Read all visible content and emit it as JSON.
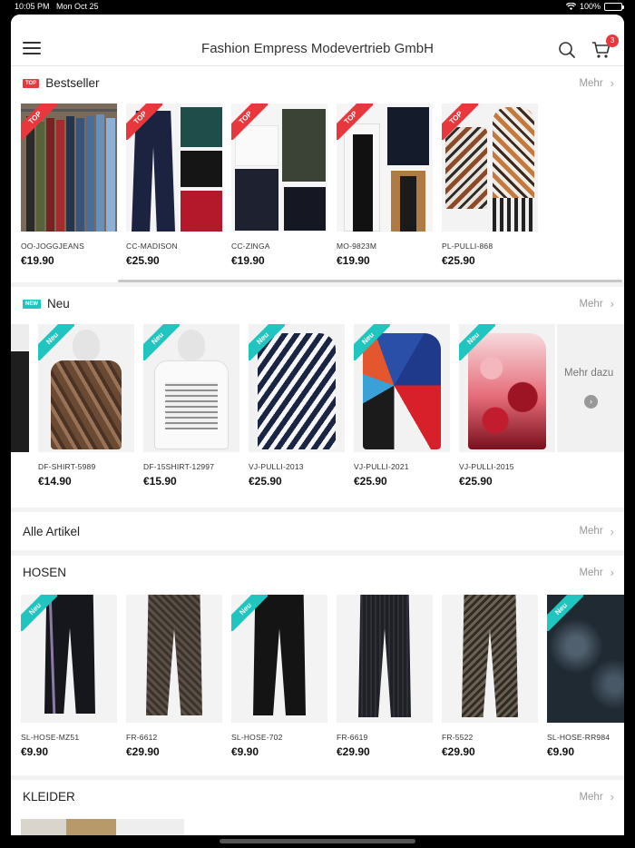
{
  "status": {
    "time": "10:05 PM",
    "date": "Mon Oct 25",
    "battery": "100%"
  },
  "header": {
    "title": "Fashion Empress Modevertrieb GmbH",
    "cart_count": "3"
  },
  "bestseller": {
    "tag": "TOP",
    "title": "Bestseller",
    "more": "Mehr",
    "items": [
      {
        "sku": "OO-JOGGJEANS",
        "price": "€19.90",
        "ribbon": "TOP"
      },
      {
        "sku": "CC-MADISON",
        "price": "€25.90",
        "ribbon": "TOP"
      },
      {
        "sku": "CC-ZINGA",
        "price": "€19.90",
        "ribbon": "TOP"
      },
      {
        "sku": "MO-9823M",
        "price": "€19.90",
        "ribbon": "TOP"
      },
      {
        "sku": "PL-PULLI-868",
        "price": "€25.90",
        "ribbon": "TOP"
      }
    ]
  },
  "neu": {
    "tag": "NEW",
    "title": "Neu",
    "more": "Mehr",
    "more_card": "Mehr dazu",
    "items": [
      {
        "sku": "DF-SHIRT-5989",
        "price": "€14.90",
        "ribbon": "Neu"
      },
      {
        "sku": "DF-15SHIRT-12997",
        "price": "€15.90",
        "ribbon": "Neu"
      },
      {
        "sku": "VJ-PULLI-2013",
        "price": "€25.90",
        "ribbon": "Neu"
      },
      {
        "sku": "VJ-PULLI-2021",
        "price": "€25.90",
        "ribbon": "Neu"
      },
      {
        "sku": "VJ-PULLI-2015",
        "price": "€25.90",
        "ribbon": "Neu"
      }
    ]
  },
  "alle": {
    "title": "Alle Artikel",
    "more": "Mehr"
  },
  "hosen": {
    "title": "HOSEN",
    "more": "Mehr",
    "items": [
      {
        "sku": "SL-HOSE-MZ51",
        "price": "€9.90",
        "ribbon": "Neu"
      },
      {
        "sku": "FR-6612",
        "price": "€29.90",
        "ribbon": ""
      },
      {
        "sku": "SL-HOSE-702",
        "price": "€9.90",
        "ribbon": "Neu"
      },
      {
        "sku": "FR-6619",
        "price": "€29.90",
        "ribbon": ""
      },
      {
        "sku": "FR-5522",
        "price": "€29.90",
        "ribbon": ""
      },
      {
        "sku": "SL-HOSE-RR984",
        "price": "€9.90",
        "ribbon": "Neu"
      }
    ]
  },
  "kleider": {
    "title": "KLEIDER",
    "more": "Mehr"
  },
  "colors": {
    "accent_red": "#e8383d",
    "accent_teal": "#1fc5be"
  }
}
